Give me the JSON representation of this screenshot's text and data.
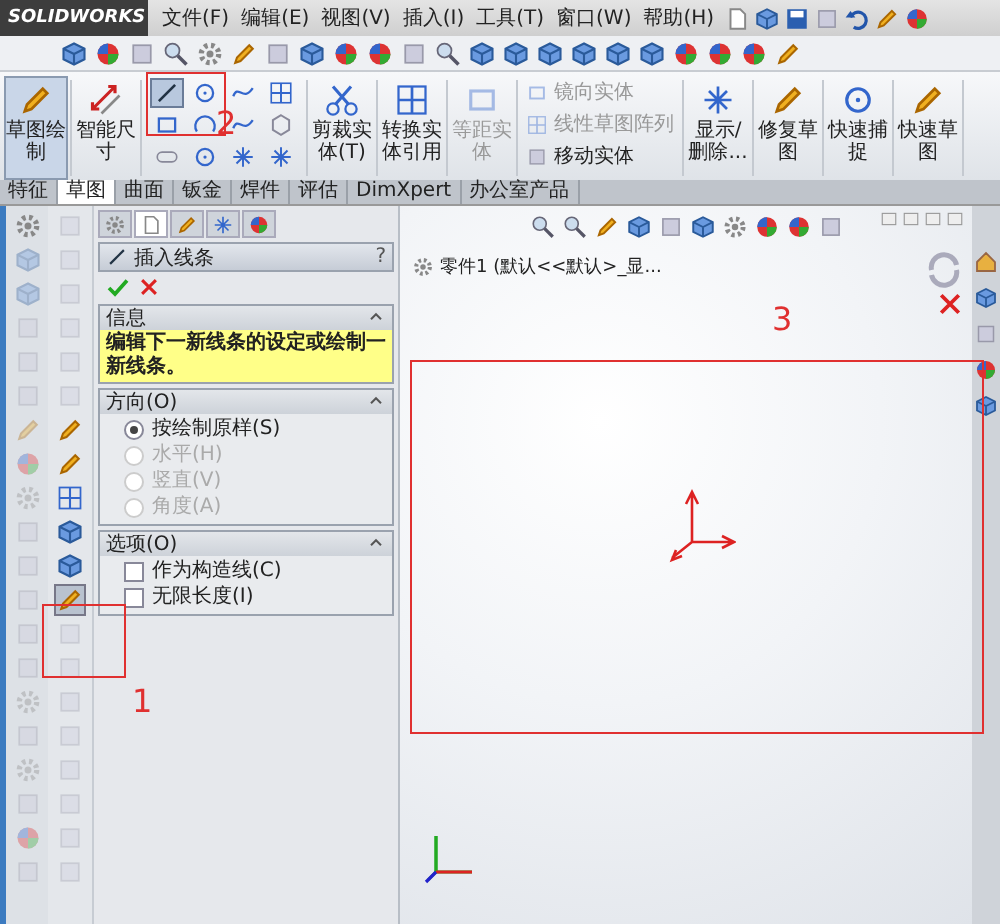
{
  "app": {
    "logo": "SOLIDWORKS"
  },
  "menu": [
    "文件(F)",
    "编辑(E)",
    "视图(V)",
    "插入(I)",
    "工具(T)",
    "窗口(W)",
    "帮助(H)"
  ],
  "ribbon": {
    "groups": [
      {
        "kind": "big",
        "label": "草图绘制",
        "selected": true,
        "disabled": false
      },
      {
        "kind": "big",
        "label": "智能尺寸",
        "selected": false,
        "disabled": false
      },
      {
        "kind": "tools",
        "tools": [
          {
            "selected": true
          },
          {
            "selected": false
          },
          {
            "selected": false
          },
          {
            "selected": false
          },
          {
            "selected": false
          },
          {
            "selected": false
          },
          {
            "selected": false
          },
          {
            "selected": false
          },
          {
            "selected": false
          },
          {
            "selected": false
          },
          {
            "selected": false
          },
          {
            "selected": false
          }
        ]
      },
      {
        "kind": "big",
        "label": "剪裁实体(T)",
        "selected": false,
        "disabled": false
      },
      {
        "kind": "big",
        "label": "转换实体引用",
        "selected": false,
        "disabled": false
      },
      {
        "kind": "big",
        "label": "等距实体",
        "selected": false,
        "disabled": true
      },
      {
        "kind": "stack",
        "items": [
          {
            "label": "镜向实体",
            "disabled": true
          },
          {
            "label": "线性草图阵列",
            "disabled": true
          },
          {
            "label": "移动实体",
            "disabled": false
          }
        ]
      },
      {
        "kind": "big",
        "label": "显示/删除...",
        "selected": false,
        "disabled": false
      },
      {
        "kind": "big",
        "label": "修复草图",
        "selected": false,
        "disabled": false
      },
      {
        "kind": "big",
        "label": "快速捕捉",
        "selected": false,
        "disabled": false
      },
      {
        "kind": "big",
        "label": "快速草图",
        "selected": false,
        "disabled": false
      }
    ]
  },
  "tabs": [
    {
      "label": "特征",
      "selected": false
    },
    {
      "label": "草图",
      "selected": true
    },
    {
      "label": "曲面",
      "selected": false
    },
    {
      "label": "钣金",
      "selected": false
    },
    {
      "label": "焊件",
      "selected": false
    },
    {
      "label": "评估",
      "selected": false
    },
    {
      "label": "DimXpert",
      "selected": false
    },
    {
      "label": "办公室产品",
      "selected": false
    }
  ],
  "panel": {
    "tabs": [
      {
        "selected": false
      },
      {
        "selected": true
      },
      {
        "selected": false
      },
      {
        "selected": false
      },
      {
        "selected": false
      }
    ],
    "title": "插入线条",
    "help": "?",
    "sections": [
      {
        "kind": "message",
        "title": "信息",
        "text": "编辑下一新线条的设定或绘制一新线条。"
      },
      {
        "kind": "radios",
        "title": "方向(O)",
        "options": [
          {
            "label": "按绘制原样(S)",
            "selected": true,
            "disabled": false
          },
          {
            "label": "水平(H)",
            "selected": false,
            "disabled": true
          },
          {
            "label": "竖直(V)",
            "selected": false,
            "disabled": true
          },
          {
            "label": "角度(A)",
            "selected": false,
            "disabled": true
          }
        ]
      },
      {
        "kind": "checks",
        "title": "选项(O)",
        "options": [
          {
            "label": "作为构造线(C)",
            "checked": false
          },
          {
            "label": "无限长度(I)",
            "checked": false
          }
        ]
      }
    ]
  },
  "graphics": {
    "tree_label": "零件1 (默认<<默认>_显..."
  },
  "annotations": [
    {
      "text": "1"
    },
    {
      "text": "2"
    },
    {
      "text": "3"
    }
  ]
}
